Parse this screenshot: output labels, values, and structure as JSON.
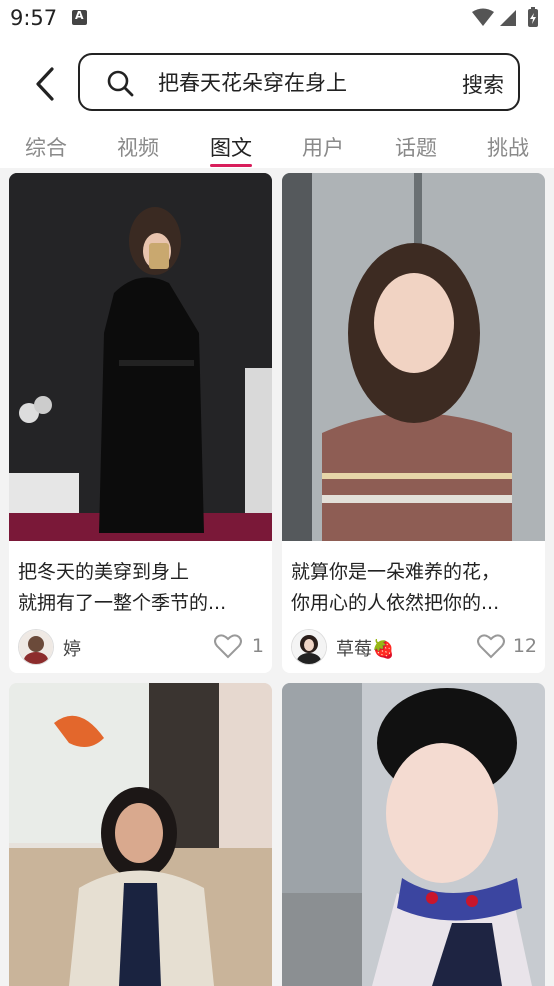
{
  "status_bar": {
    "time": "9:57"
  },
  "search": {
    "query": "把春天花朵穿在身上",
    "button": "搜索"
  },
  "tabs": [
    "综合",
    "视频",
    "图文",
    "用户",
    "话题",
    "挑战"
  ],
  "active_tab": "图文",
  "colors": {
    "accent": "#d81e5b",
    "background": "#f3f3f3"
  },
  "cards": [
    {
      "caption_line1": "把冬天的美穿到身上",
      "caption_line2": "就拥有了一整个季节的...",
      "author": "婷",
      "likes": "1"
    },
    {
      "caption_line1": "就算你是一朵难养的花，",
      "caption_line2": "你用心的人依然把你的...",
      "author": "草莓🍓",
      "likes": "12"
    },
    {
      "caption_line1": "",
      "caption_line2": "",
      "author": "",
      "likes": ""
    },
    {
      "caption_line1": "",
      "caption_line2": "",
      "author": "",
      "likes": ""
    }
  ]
}
